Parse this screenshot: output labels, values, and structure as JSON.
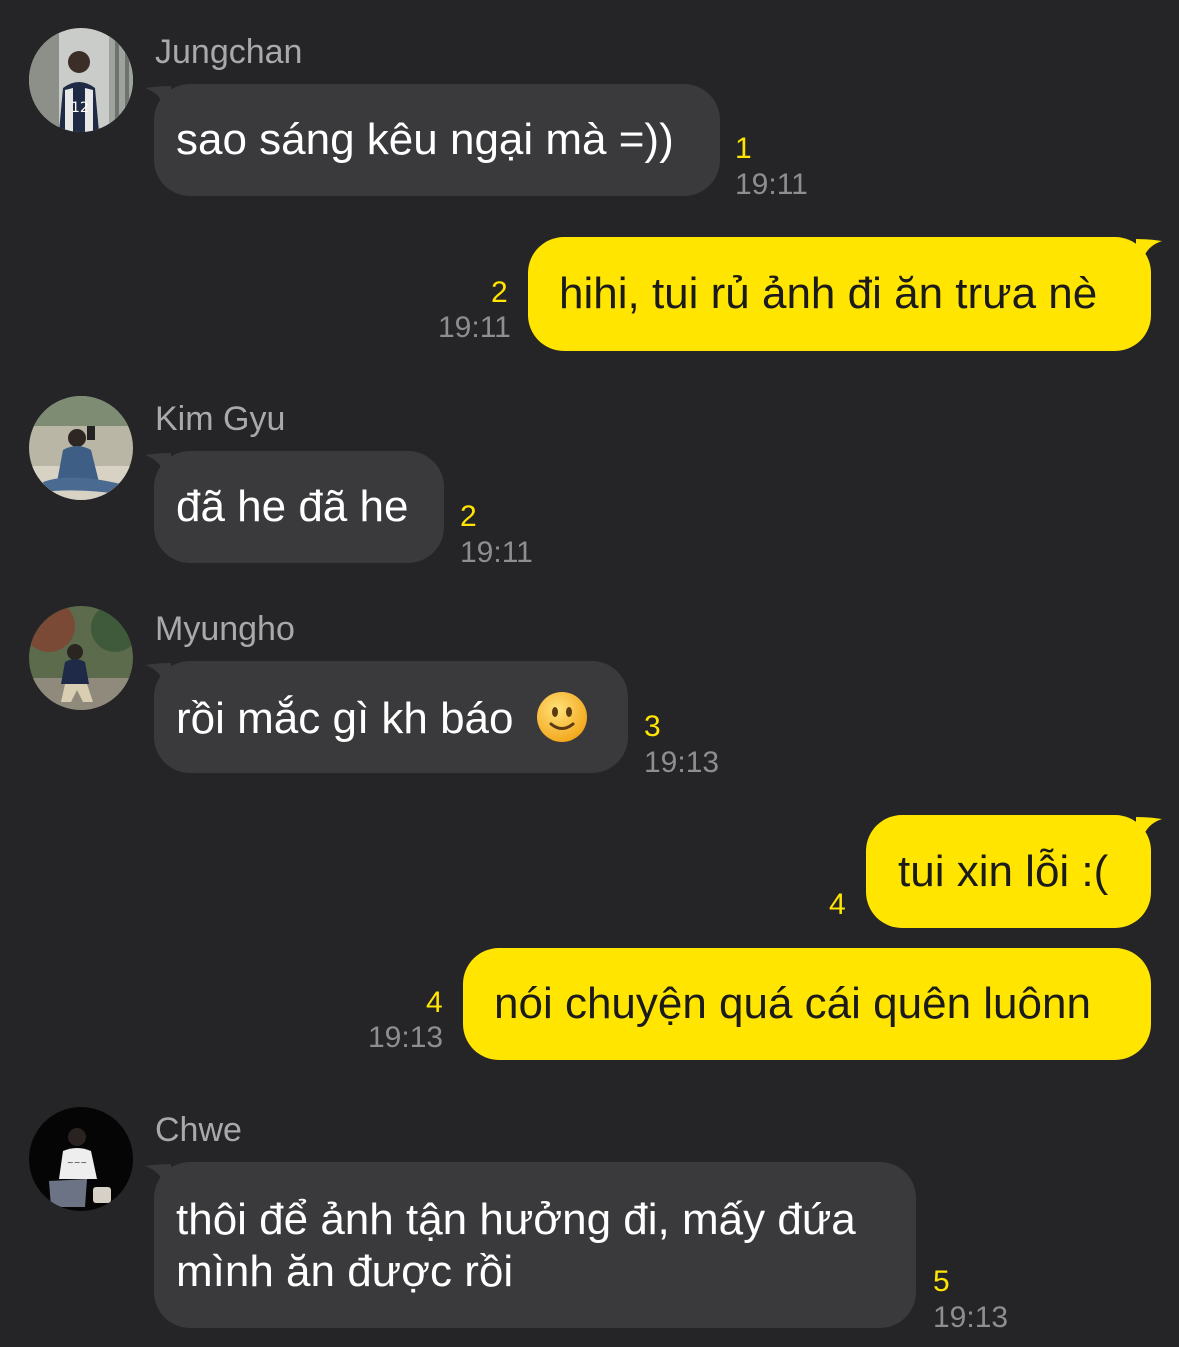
{
  "colors": {
    "background": "#252527",
    "incoming_bubble": "#3a3a3c",
    "outgoing_bubble": "#ffe500",
    "unread_count": "#ffe500",
    "timestamp": "#8e8e90"
  },
  "messages": [
    {
      "sender": "Jungchan",
      "text": "sao sáng kêu ngại mà =))",
      "unread": "1",
      "time": "19:11"
    },
    {
      "sender": "",
      "text": "hihi, tui rủ ảnh đi ăn trưa nè",
      "unread": "2",
      "time": "19:11"
    },
    {
      "sender": "Kim Gyu",
      "text": "đã he đã he",
      "unread": "2",
      "time": "19:11"
    },
    {
      "sender": "Myungho",
      "text": "rồi mắc gì kh báo",
      "emoji": "slightly-smiling-face-icon",
      "unread": "3",
      "time": "19:13"
    },
    {
      "sender": "",
      "text": "tui xin lỗi :(",
      "unread": "4",
      "time": ""
    },
    {
      "sender": "",
      "text": "nói chuyện quá cái quên luônn",
      "unread": "4",
      "time": "19:13"
    },
    {
      "sender": "Chwe",
      "text_line1": "thôi để ảnh tận hưởng đi, mấy đứa",
      "text_line2": "mình ăn được rồi",
      "unread": "5",
      "time": "19:13"
    }
  ]
}
